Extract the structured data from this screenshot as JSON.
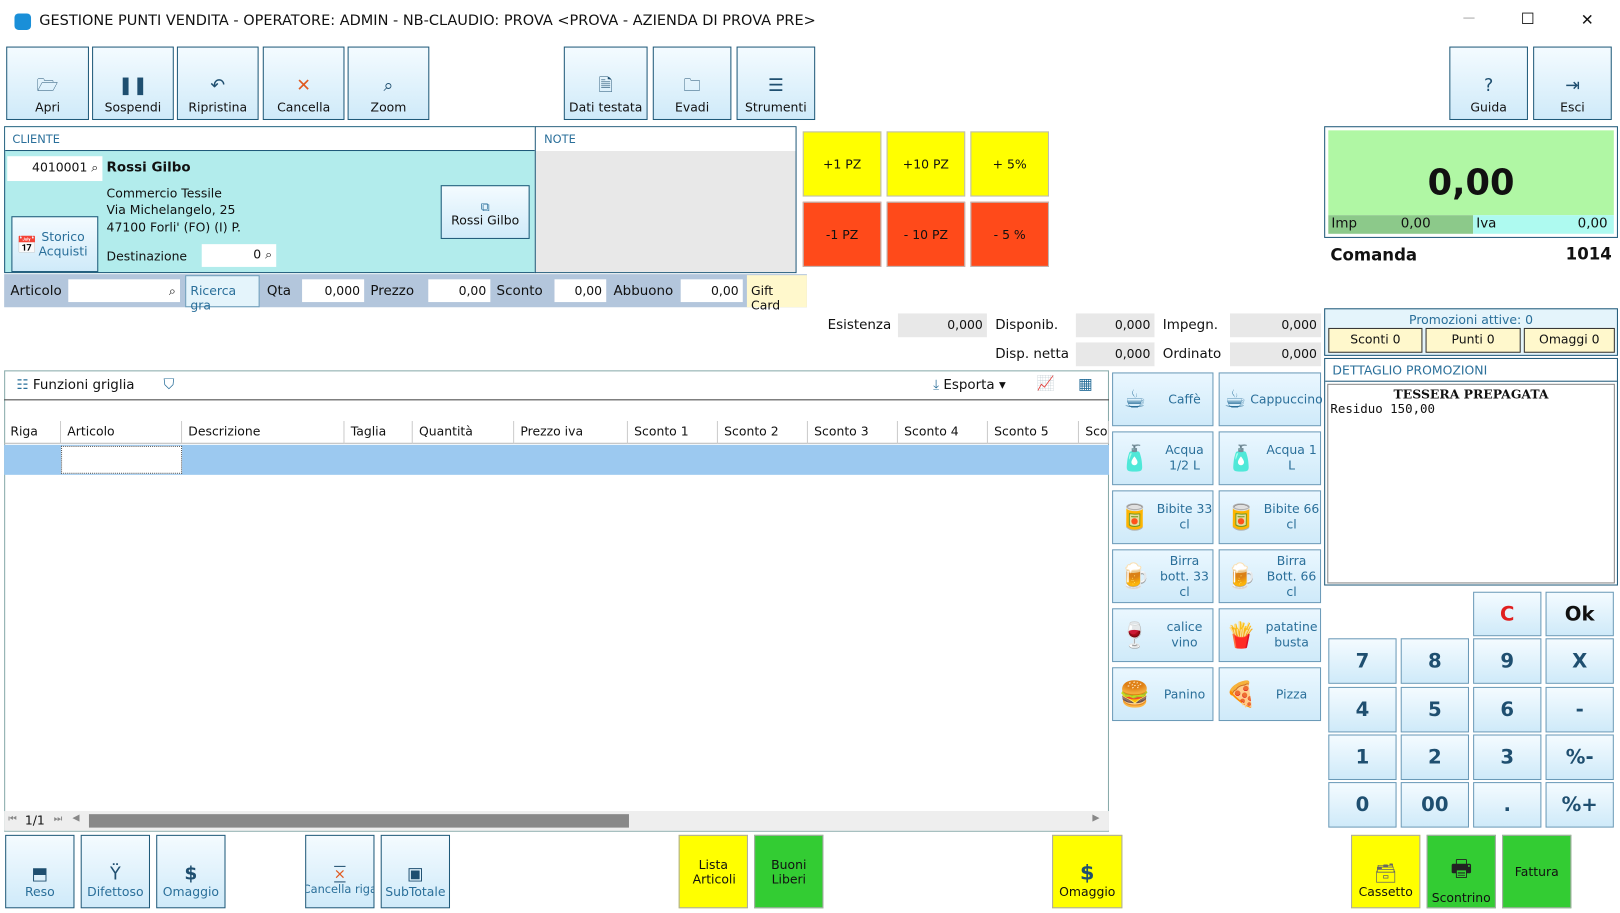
{
  "window": {
    "title": "GESTIONE PUNTI VENDITA - OPERATORE: ADMIN - NB-CLAUDIO: PROVA <PROVA - AZIENDA DI PROVA PRE>",
    "minimize": "—",
    "maximize": "☐",
    "close": "✕"
  },
  "toolbar": [
    {
      "label": "Apri",
      "icon": "folder-open-icon",
      "glyph": "🗁"
    },
    {
      "label": "Sospendi",
      "icon": "pause-icon",
      "glyph": "❚❚"
    },
    {
      "label": "Ripristina",
      "icon": "undo-icon",
      "glyph": "↶"
    },
    {
      "label": "Cancella",
      "icon": "cancel-icon",
      "glyph": "✕"
    },
    {
      "label": "Zoom",
      "icon": "zoom-icon",
      "glyph": "⌕"
    },
    {
      "label": "Dati testata",
      "icon": "document-icon",
      "glyph": "🗎"
    },
    {
      "label": "Evadi",
      "icon": "folder-icon",
      "glyph": "🗀"
    },
    {
      "label": "Strumenti",
      "icon": "menu-icon",
      "glyph": "☰"
    },
    {
      "label": "Guida",
      "icon": "help-icon",
      "glyph": "?"
    },
    {
      "label": "Esci",
      "icon": "exit-icon",
      "glyph": "⇥"
    }
  ],
  "cliente": {
    "header": "CLIENTE",
    "code": "4010001",
    "name": "Rossi Gilbo",
    "line1": "Commercio Tessile",
    "line2": "Via Michelangelo, 25",
    "line3": "47100 Forli'  (FO) (I) P.",
    "storico": "Storico Acquisti",
    "dest_label": "Destinazione",
    "dest_value": "0",
    "card_button": "Rossi Gilbo"
  },
  "note": {
    "header": "NOTE"
  },
  "quick": [
    "+1 PZ",
    "+10 PZ",
    "+ 5%",
    "-1 PZ",
    "- 10 PZ",
    "- 5 %"
  ],
  "articolo_row": {
    "articolo": "Articolo",
    "ricerca": "Ricerca gra",
    "qta": "Qta",
    "qta_val": "0,000",
    "prezzo": "Prezzo",
    "prezzo_val": "0,00",
    "sconto": "Sconto",
    "sconto_val": "0,00",
    "abbuono": "Abbuono",
    "abbuono_val": "0,00",
    "giftcard": "Gift Card"
  },
  "stock": {
    "esistenza": "Esistenza",
    "esistenza_val": "0,000",
    "disponib": "Disponib.",
    "disponib_val": "0,000",
    "impegn": "Impegn.",
    "impegn_val": "0,000",
    "disp_netta": "Disp. netta",
    "disp_netta_val": "0,000",
    "ordinato": "Ordinato",
    "ordinato_val": "0,000"
  },
  "grid": {
    "funzioni": "Funzioni griglia",
    "esporta": "Esporta",
    "columns": [
      "Riga",
      "Articolo",
      "Descrizione",
      "Taglia",
      "Quantità",
      "Prezzo iva",
      "Sconto 1",
      "Sconto 2",
      "Sconto 3",
      "Sconto 4",
      "Sconto 5",
      "Scon"
    ],
    "pager": "1/1"
  },
  "products": [
    {
      "label": "Caffè",
      "icon": "coffee-icon",
      "glyph": "☕"
    },
    {
      "label": "Cappuccino",
      "icon": "cappuccino-icon",
      "glyph": "☕"
    },
    {
      "label": "Acqua 1/2 L",
      "icon": "water-bottle-icon",
      "glyph": "🧴"
    },
    {
      "label": "Acqua 1 L",
      "icon": "water-bottle-icon",
      "glyph": "🧴"
    },
    {
      "label": "Bibite 33 cl",
      "icon": "soda-can-icon",
      "glyph": "🥫"
    },
    {
      "label": "Bibite 66 cl",
      "icon": "soda-can-icon",
      "glyph": "🥫"
    },
    {
      "label": "Birra bott. 33 cl",
      "icon": "beer-bottle-icon",
      "glyph": "🍺"
    },
    {
      "label": "Birra Bott. 66 cl",
      "icon": "beer-bottle-icon",
      "glyph": "🍺"
    },
    {
      "label": "calice vino",
      "icon": "wine-glass-icon",
      "glyph": "🍷"
    },
    {
      "label": "patatine busta",
      "icon": "chips-icon",
      "glyph": "🍟"
    },
    {
      "label": "Panino",
      "icon": "sandwich-icon",
      "glyph": "🍔"
    },
    {
      "label": "Pizza",
      "icon": "pizza-icon",
      "glyph": "🍕"
    }
  ],
  "display": {
    "total": "0,00",
    "imp_label": "Imp",
    "imp": "0,00",
    "iva_label": "Iva",
    "iva": "0,00",
    "comanda_label": "Comanda",
    "comanda": "1014"
  },
  "promo": {
    "title": "Promozioni attive: 0",
    "sconti": "Sconti 0",
    "punti": "Punti 0",
    "omaggi": "Omaggi 0",
    "dettaglio": "DETTAGLIO PROMOZIONI",
    "tessera": "TESSERA PREPAGATA",
    "residuo": "Residuo 150,00"
  },
  "keypad": [
    "C",
    "Ok",
    "7",
    "8",
    "9",
    "X",
    "4",
    "5",
    "6",
    "-",
    "1",
    "2",
    "3",
    "%-",
    "0",
    "00",
    ".",
    "%+"
  ],
  "bottom": {
    "reso": "Reso",
    "difettoso": "Difettoso",
    "omaggio": "Omaggio",
    "cancella_riga": "Cancella riga",
    "subtotale": "SubTotale",
    "lista": "Lista Articoli",
    "buoni": "Buoni Liberi",
    "omaggio2": "Omaggio",
    "cassetto": "Cassetto",
    "scontrino": "Scontrino",
    "fattura": "Fattura"
  },
  "colors": {
    "yellow": "#ffff00",
    "green": "#33cc33",
    "red": "#ff4a1a",
    "cyan": "#b2ecec",
    "display": "#b0f7a4"
  }
}
